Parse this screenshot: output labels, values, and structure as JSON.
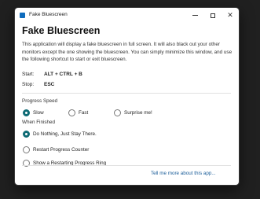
{
  "window": {
    "title": "Fake Bluescreen"
  },
  "content": {
    "heading": "Fake Bluescreen",
    "description": "This application will display a fake bluescreen in full screen. It will also black out your other monitors except the one showing the bluescreen. You can simply minimize this window, and use the following shortcut to start or exit bluescreen.",
    "start_label": "Start:",
    "start_value": "ALT + CTRL + B",
    "stop_label": "Stop:",
    "stop_value": "ESC"
  },
  "progress_speed": {
    "label": "Progress Speed",
    "options": [
      {
        "label": "Slow",
        "selected": true
      },
      {
        "label": "Fast",
        "selected": false
      },
      {
        "label": "Surprise me!",
        "selected": false
      }
    ]
  },
  "when_finished": {
    "label": "When Finished",
    "options": [
      {
        "label": "Do Nothing, Just Stay There.",
        "selected": true
      },
      {
        "label": "Restart Progress Counter",
        "selected": false
      },
      {
        "label": "Show a Restarting Progress Ring",
        "selected": false
      }
    ]
  },
  "footer": {
    "link": "Tell me more about this app..."
  },
  "colors": {
    "accent": "#0f6b75",
    "link": "#1a5d99",
    "background": "#202020"
  }
}
